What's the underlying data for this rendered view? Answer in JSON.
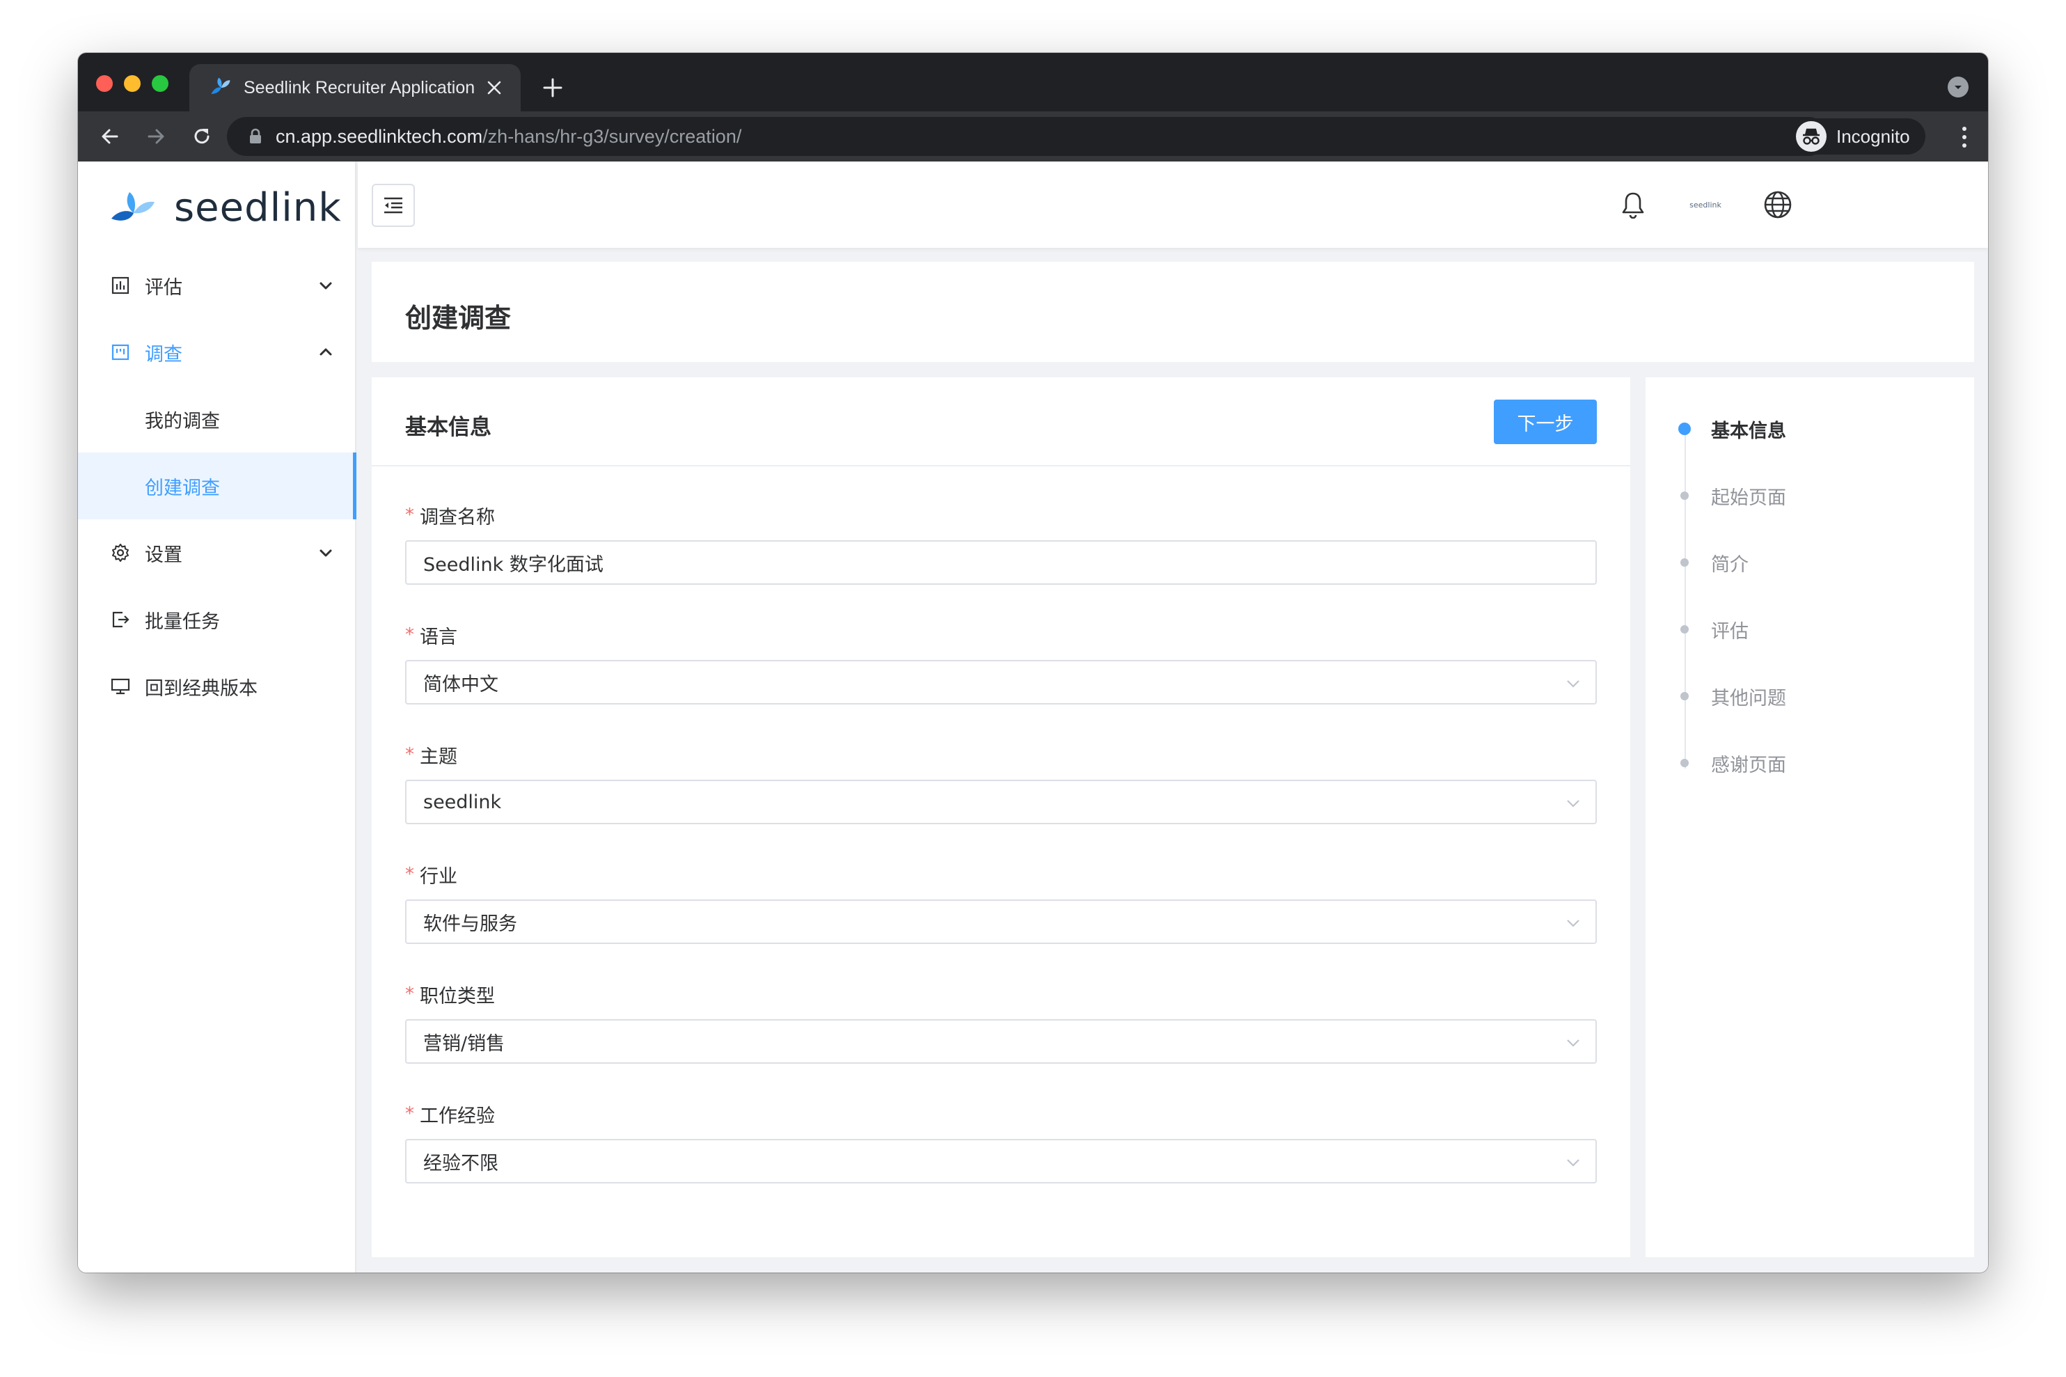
{
  "browser": {
    "tab_title": "Seedlink Recruiter Application",
    "url_host": "cn.app.seedlinktech.com",
    "url_path": "/zh-hans/hr-g3/survey/creation/",
    "incognito_label": "Incognito"
  },
  "sidebar": {
    "logo_text": "seedlink",
    "items": [
      {
        "label": "评估"
      },
      {
        "label": "调查"
      },
      {
        "label": "我的调查"
      },
      {
        "label": "创建调查"
      },
      {
        "label": "设置"
      },
      {
        "label": "批量任务"
      },
      {
        "label": "回到经典版本"
      }
    ]
  },
  "topbar": {
    "avatar_text": "seedlink"
  },
  "page": {
    "title": "创建调查"
  },
  "form": {
    "section_title": "基本信息",
    "next_button": "下一步",
    "required_mark": "*",
    "fields": [
      {
        "label": "调查名称",
        "value": "Seedlink 数字化面试"
      },
      {
        "label": "语言",
        "value": "简体中文"
      },
      {
        "label": "主题",
        "value": "seedlink"
      },
      {
        "label": "行业",
        "value": "软件与服务"
      },
      {
        "label": "职位类型",
        "value": "营销/销售"
      },
      {
        "label": "工作经验",
        "value": "经验不限"
      }
    ]
  },
  "steps": [
    {
      "label": "基本信息",
      "active": true
    },
    {
      "label": "起始页面",
      "active": false
    },
    {
      "label": "简介",
      "active": false
    },
    {
      "label": "评估",
      "active": false
    },
    {
      "label": "其他问题",
      "active": false
    },
    {
      "label": "感谢页面",
      "active": false
    }
  ],
  "colors": {
    "primary": "#409eff",
    "required": "#f56c6c",
    "chrome_dark": "#202124"
  }
}
